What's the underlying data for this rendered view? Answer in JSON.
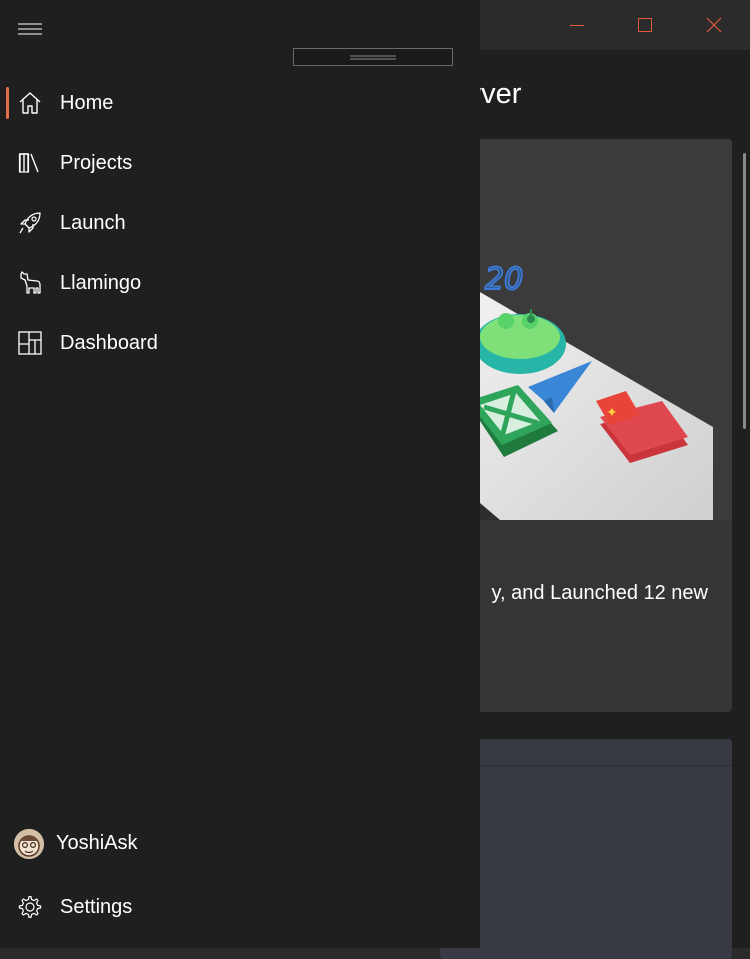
{
  "window": {
    "controls": [
      "minimize-icon",
      "maximize-icon",
      "close-icon"
    ],
    "control_color": "#e05a3a"
  },
  "page": {
    "title_fragment": "l Discord server"
  },
  "card1": {
    "text_fragment": "y, and Launched 12 new",
    "image_fragment_text": "20"
  },
  "nav": {
    "toggle_icon": "hamburger-icon",
    "accent": "#e0704a",
    "items": [
      {
        "label": "Home",
        "icon": "home-icon",
        "selected": true
      },
      {
        "label": "Projects",
        "icon": "library-icon",
        "selected": false
      },
      {
        "label": "Launch",
        "icon": "rocket-icon",
        "selected": false
      },
      {
        "label": "Llamingo",
        "icon": "llama-icon",
        "selected": false
      },
      {
        "label": "Dashboard",
        "icon": "dashboard-icon",
        "selected": false
      }
    ],
    "footer": {
      "user": {
        "label": "YoshiAsk",
        "icon": "avatar"
      },
      "settings": {
        "label": "Settings",
        "icon": "gear-icon"
      }
    }
  }
}
